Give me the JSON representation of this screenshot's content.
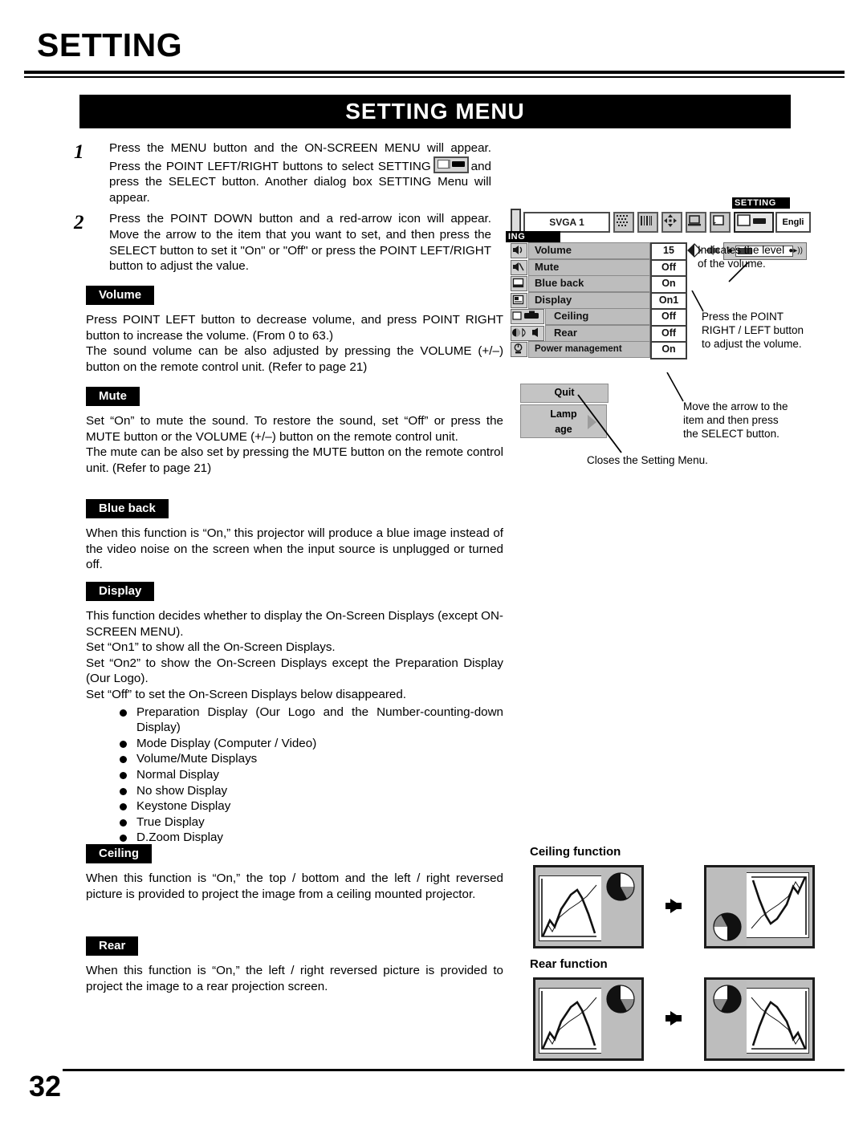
{
  "header": {
    "title": "SETTING",
    "banner": "SETTING MENU"
  },
  "steps": [
    {
      "num": "1",
      "text_before_icon": "Press the MENU button and the ON-SCREEN MENU will appear.  Press the POINT LEFT/RIGHT buttons to select SETTING",
      "icon": "setting-menu-icon",
      "text_after_icon": "and press the SELECT button.  Another dialog box SETTING Menu will appear."
    },
    {
      "num": "2",
      "text_before_icon": "Press the POINT DOWN button and a red-arrow icon will appear.  Move the arrow to the item that you want to set, and then press the SELECT button to set it \"On\" or \"Off\" or press the POINT LEFT/RIGHT button to adjust the value.",
      "icon": "",
      "text_after_icon": ""
    }
  ],
  "sections": [
    {
      "label": "Volume",
      "paragraphs": [
        "Press POINT LEFT button to decrease volume, and press POINT RIGHT button to increase the volume.  (From 0 to 63.)",
        "The sound volume can be also adjusted by pressing the VOLUME (+/–) button  on the remote control unit.  (Refer to page 21)"
      ]
    },
    {
      "label": "Mute",
      "paragraphs": [
        "Set “On” to mute the sound.  To restore the sound, set “Off” or press the MUTE button  or the VOLUME (+/–) button on the remote control unit.",
        "The mute can be also set by pressing the MUTE button on the remote control unit.  (Refer to page 21)"
      ]
    },
    {
      "label": "Blue back",
      "paragraphs": [
        "When this function is “On,” this projector will produce a blue image instead of the video noise on the screen when the input source is unplugged or turned off."
      ]
    },
    {
      "label": "Display",
      "paragraphs": [
        "This function decides  whether to display the On-Screen Displays (except ON-SCREEN MENU).",
        "Set “On1” to show all the On-Screen Displays.",
        "Set “On2” to show the On-Screen Displays except the Preparation Display (Our Logo).",
        "Set “Off” to set the On-Screen Displays below disappeared."
      ],
      "bullets": [
        "Preparation Display (Our Logo and the Number-counting-down Display)",
        "Mode Display (Computer / Video)",
        "Volume/Mute Displays",
        "Normal Display",
        "No show Display",
        "Keystone Display",
        "True Display",
        "D.Zoom Display"
      ]
    },
    {
      "label": "Ceiling",
      "paragraphs": [
        "When this function is “On,” the top / bottom and the left / right reversed picture is provided to project the image from a ceiling mounted projector."
      ]
    },
    {
      "label": "Rear",
      "paragraphs": [
        "When this function is “On,” the left / right reversed picture is provided to project the image to a rear projection screen."
      ]
    }
  ],
  "osd": {
    "menubar": {
      "source": "SVGA 1",
      "selected_tag": "SETTING",
      "left_tag": "ING",
      "language": "Engli",
      "icons": [
        "pattern-icon",
        "color-bars-icon",
        "position-icon",
        "computer-icon",
        "screen-icon",
        "setting-selected-icon"
      ]
    },
    "rows": [
      {
        "icon": "volume-icon",
        "label": "Volume",
        "value": "15",
        "indent": false,
        "small": false
      },
      {
        "icon": "mute-icon",
        "label": "Mute",
        "value": "Off",
        "indent": false,
        "small": false
      },
      {
        "icon": "blue-back-icon",
        "label": "Blue back",
        "value": "On",
        "indent": false,
        "small": false
      },
      {
        "icon": "display-icon",
        "label": "Display",
        "value": "On1",
        "indent": false,
        "small": false
      },
      {
        "icon": "ceiling-icon",
        "label": "Ceiling",
        "value": "Off",
        "indent": true,
        "small": false
      },
      {
        "icon": "rear-icon",
        "label": "Rear",
        "value": "Off",
        "indent": true,
        "small": false
      },
      {
        "icon": "power-management-icon",
        "label": "Power management",
        "value": "On",
        "indent": false,
        "small": true
      }
    ],
    "buttons": {
      "quit": "Quit",
      "lamp_age_line1": "Lamp",
      "lamp_age_line2": "age"
    },
    "volume_widget": {
      "level": "15",
      "speaker_glyph": "●▸))"
    }
  },
  "callouts": {
    "level": "Indicates the level\nof the volume.",
    "level_line1": "Indicates the level",
    "level_line2": "of the volume.",
    "adjust_line1": "Press the POINT",
    "adjust_line2": "RIGHT / LEFT button",
    "adjust_line3": "to adjust the volume.",
    "select_line1": "Move the arrow to the",
    "select_line2": "item and then press",
    "select_line3": "the SELECT button.",
    "quit_note": "Closes the Setting Menu."
  },
  "diagrams": [
    {
      "title": "Ceiling function",
      "mode": "rotate-180"
    },
    {
      "title": "Rear function",
      "mode": "mirror-horizontal"
    }
  ],
  "footer": {
    "page_number": "32"
  }
}
